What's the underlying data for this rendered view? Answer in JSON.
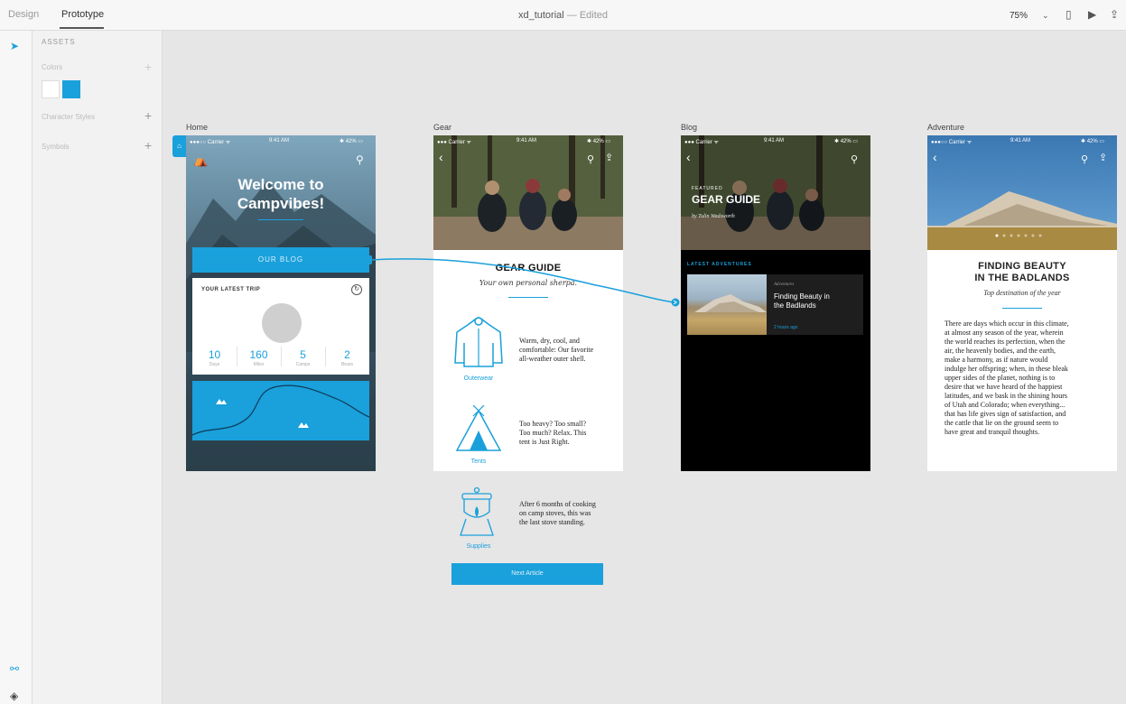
{
  "app": {
    "tabs": [
      "Design",
      "Prototype"
    ],
    "title": "xd_tutorial",
    "title_suffix": "— Edited",
    "zoom": "75%"
  },
  "assets": {
    "title": "ASSETS",
    "colors_label": "Colors",
    "char_styles_label": "Character Styles",
    "symbols_label": "Symbols",
    "swatches": [
      "#ffffff",
      "#1aa0db"
    ]
  },
  "colors": {
    "accent": "#1aa0db",
    "canvas": "#e6e6e6"
  },
  "artboards": {
    "home": {
      "label": "Home",
      "status": {
        "carrier": "●●●○○ Carrier ᯤ",
        "time": "9:41 AM",
        "battery": "✱ 42% ▭"
      },
      "welcome_line1": "Welcome to",
      "welcome_line2": "Campvibes!",
      "blog_button": "OUR BLOG",
      "trip_title": "YOUR LATEST TRIP",
      "stats": [
        {
          "value": "10",
          "label": "Days"
        },
        {
          "value": "160",
          "label": "Miles"
        },
        {
          "value": "5",
          "label": "Camps"
        },
        {
          "value": "2",
          "label": "Bears"
        }
      ]
    },
    "gear": {
      "label": "Gear",
      "status": {
        "carrier": "●●● Carrier ᯤ",
        "time": "9:41 AM",
        "battery": "✱ 42% ▭"
      },
      "title": "GEAR GUIDE",
      "subtitle": "Your own personal sherpa.",
      "items": [
        {
          "label": "Outerwear",
          "text_lines": [
            "Warm, dry, cool, and",
            "comfortable: Our favorite",
            "all-weather outer shell."
          ]
        },
        {
          "label": "Tents",
          "text_lines": [
            "Too heavy? Too small?",
            "Too much? Relax. This",
            "tent is Just Right."
          ]
        },
        {
          "label": "Supplies",
          "text_lines": [
            "After 6 months of cooking",
            "on camp stoves, this was",
            "the last stove standing."
          ]
        }
      ],
      "next_button": "Next Article"
    },
    "blog": {
      "label": "Blog",
      "status": {
        "carrier": "●●● Carrier ᯤ",
        "time": "9:41 AM",
        "battery": "✱ 42% ▭"
      },
      "featured": "FEATURED",
      "headline": "GEAR GUIDE",
      "byline": "by Tulin Wadsworth",
      "latest": "LATEST ADVENTURES",
      "card": {
        "category": "Adventures",
        "title_line1": "Finding Beauty in",
        "title_line2": "the Badlands",
        "time": "2 hours ago"
      }
    },
    "adventure": {
      "label": "Adventure",
      "status": {
        "carrier": "●●●○○ Carrier ᯤ",
        "time": "9:41 AM",
        "battery": "✱ 42% ▭"
      },
      "title_line1": "FINDING BEAUTY",
      "title_line2": "IN THE BADLANDS",
      "subtitle": "Top destination of the year",
      "body_lines": [
        "There are days which occur in this climate,",
        "at almost any season of the year, wherein",
        "the world reaches its perfection, when the",
        "air, the heavenly bodies, and the earth,",
        "make a harmony, as if nature would",
        "indulge her offspring; when, in these bleak",
        "upper sides of the planet, nothing is to",
        "desire that we have heard of the happiest",
        "latitudes, and we bask in the shining hours",
        "of Utah and Colorado; when everything...",
        "that has life gives sign of satisfaction, and",
        "the cattle that lie on the ground seem to",
        "have great and tranquil thoughts."
      ]
    }
  }
}
